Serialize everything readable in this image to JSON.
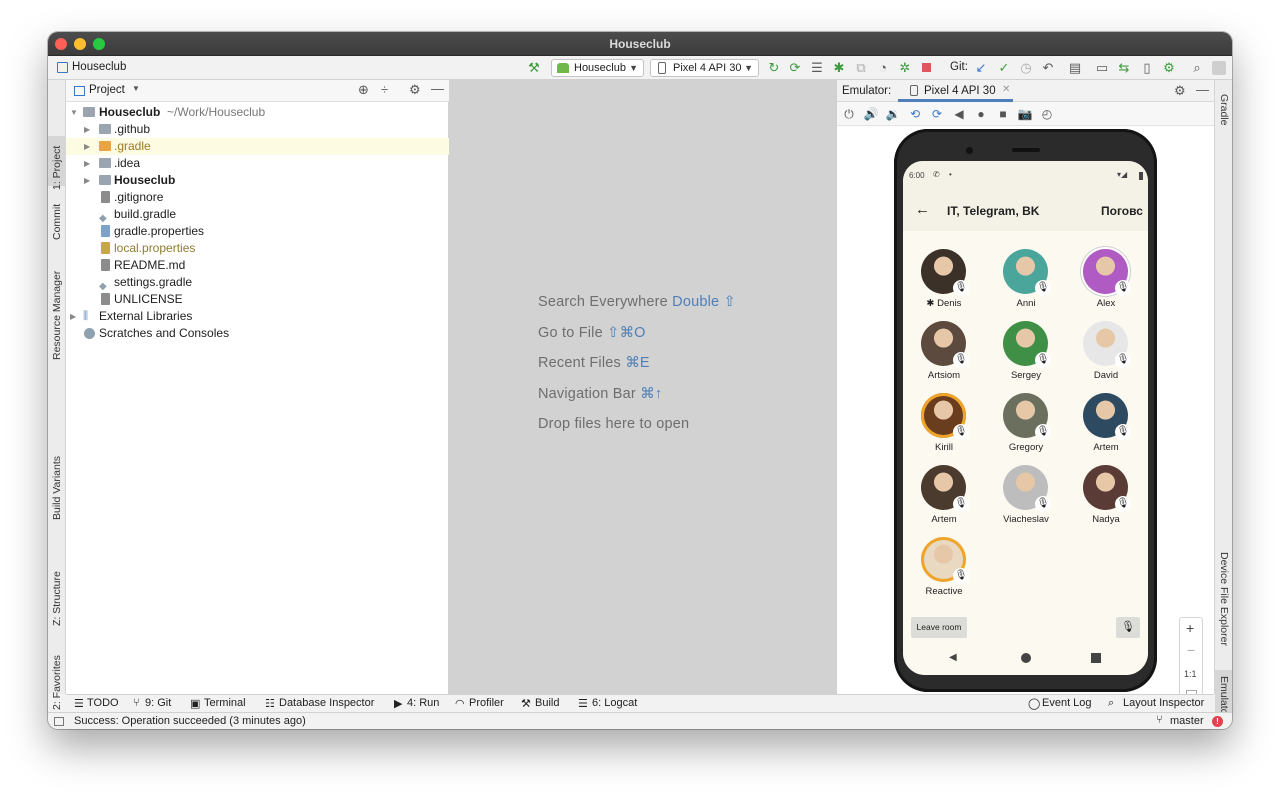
{
  "window": {
    "title": "Houseclub"
  },
  "toolbar": {
    "breadcrumb": "Houseclub",
    "run_config": "Houseclub",
    "device": "Pixel 4 API 30",
    "git_label": "Git:"
  },
  "left_tabs": [
    "1: Project",
    "Commit",
    "Resource Manager",
    "Build Variants",
    "Z: Structure",
    "2: Favorites"
  ],
  "right_tabs": [
    "Gradle",
    "Device File Explorer",
    "Emulator"
  ],
  "project_panel": {
    "title": "Project",
    "root_name": "Houseclub",
    "root_path": "~/Work/Houseclub",
    "items": [
      {
        "label": ".github"
      },
      {
        "label": ".gradle"
      },
      {
        "label": ".idea"
      },
      {
        "label": "Houseclub"
      },
      {
        "label": ".gitignore"
      },
      {
        "label": "build.gradle"
      },
      {
        "label": "gradle.properties"
      },
      {
        "label": "local.properties"
      },
      {
        "label": "README.md"
      },
      {
        "label": "settings.gradle"
      },
      {
        "label": "UNLICENSE"
      }
    ],
    "external_libraries": "External Libraries",
    "scratches": "Scratches and Consoles"
  },
  "editor": {
    "hints": [
      {
        "text": "Search Everywhere ",
        "key": "Double ⇧"
      },
      {
        "text": "Go to File ",
        "key": "⇧⌘O"
      },
      {
        "text": "Recent Files ",
        "key": "⌘E"
      },
      {
        "text": "Navigation Bar ",
        "key": "⌘↑"
      },
      {
        "text": "Drop files here to open",
        "key": ""
      }
    ]
  },
  "emulator": {
    "label": "Emulator:",
    "tab": "Pixel 4 API 30",
    "zoom_label": "1:1",
    "phone": {
      "time": "6:00",
      "title": "IT, Telegram, BK",
      "title_right": "Поговс",
      "leave_button": "Leave room",
      "users": [
        {
          "name": "✱ Denis",
          "color": "#3b3129"
        },
        {
          "name": "Anni",
          "color": "#4aa59a"
        },
        {
          "name": "Alex",
          "color": "#b05ac4"
        },
        {
          "name": "Artsiom",
          "color": "#5b4a3d"
        },
        {
          "name": "Sergey",
          "color": "#3f8f47"
        },
        {
          "name": "David",
          "color": "#e7e7e7"
        },
        {
          "name": "Kirill",
          "color": "#6b3d1f"
        },
        {
          "name": "Gregory",
          "color": "#6b6f5e"
        },
        {
          "name": "Artem",
          "color": "#2d4a61"
        },
        {
          "name": "Artem",
          "color": "#4b3a2e"
        },
        {
          "name": "Viacheslav",
          "color": "#bdbdbd"
        },
        {
          "name": "Nadya",
          "color": "#5a3b36"
        },
        {
          "name": "Reactive",
          "color": "#e8d9c0"
        }
      ]
    }
  },
  "bottom_tools": [
    {
      "label": "TODO"
    },
    {
      "label": "9: Git"
    },
    {
      "label": "Terminal"
    },
    {
      "label": "Database Inspector"
    },
    {
      "label": "4: Run"
    },
    {
      "label": "Profiler"
    },
    {
      "label": "Build"
    },
    {
      "label": "6: Logcat"
    }
  ],
  "bottom_right": {
    "event_log": "Event Log",
    "layout_inspector": "Layout Inspector"
  },
  "status": {
    "message": "Success: Operation succeeded (3 minutes ago)",
    "branch": "master"
  },
  "colors": {
    "accent": "#4f7fb8",
    "selection": "#fdfbe2",
    "phone_bg": "#fcf9f1"
  }
}
